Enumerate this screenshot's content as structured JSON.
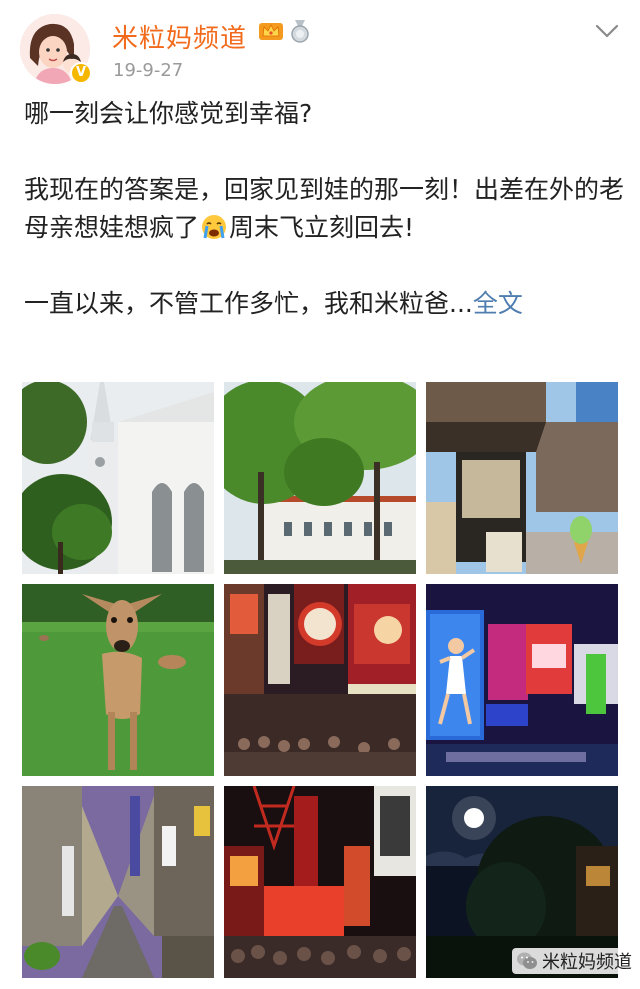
{
  "post": {
    "username": "米粒妈频道",
    "date": "19-9-27",
    "paragraph1": "哪一刻会让你感觉到幸福?",
    "paragraph2_part1": "我现在的答案是，回家见到娃的那一刻！出差在外的老母亲想娃想疯了",
    "paragraph2_part2": "周末飞立刻回去!",
    "paragraph3": "一直以来，不管工作多忙，我和米粒爸...",
    "full_text_link": "全文"
  },
  "icons": {
    "verified": "verified-badge-icon",
    "crown": "crown-badge-icon",
    "medal": "medal-badge-icon",
    "more": "chevron-down-icon",
    "emoji": "crying-face-emoji-icon",
    "watermark": "wechat-icon"
  },
  "photos": [
    {
      "name": "photo-church"
    },
    {
      "name": "photo-white-building-trees"
    },
    {
      "name": "photo-market-stall-icecream"
    },
    {
      "name": "photo-deer"
    },
    {
      "name": "photo-neon-street"
    },
    {
      "name": "photo-glico-sign"
    },
    {
      "name": "photo-shopping-street"
    },
    {
      "name": "photo-night-tower"
    },
    {
      "name": "photo-night-moon"
    }
  ],
  "watermark": {
    "text": "米粒妈频道"
  },
  "colors": {
    "username": "#f26b1d",
    "link": "#507daf",
    "date": "#9a9a9a"
  }
}
